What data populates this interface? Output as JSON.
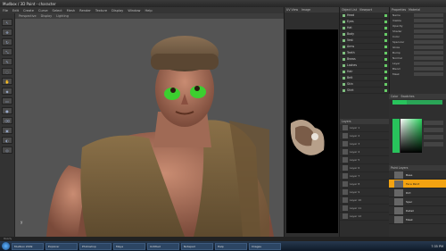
{
  "window": {
    "title": "Mudbox / 3D Paint - character"
  },
  "menu": [
    "File",
    "Edit",
    "Create",
    "Curve",
    "Select",
    "Mesh",
    "Render",
    "Texture",
    "Display",
    "Window",
    "Help"
  ],
  "viewport": {
    "tabs": [
      "Perspective",
      "Display",
      "Lighting"
    ],
    "axis_label": "y"
  },
  "uv_panel": {
    "tabs": [
      "UV View",
      "Image"
    ]
  },
  "object_list": {
    "tabs": [
      "Object List",
      "Viewport"
    ],
    "items": [
      "Head",
      "Eyes",
      "Hat",
      "Body",
      "Vest",
      "Arms",
      "Teeth",
      "Brows",
      "Lashes",
      "Hair",
      "Belt",
      "Skin",
      "Shirt"
    ]
  },
  "properties": {
    "tabs": [
      "Properties",
      "Material"
    ],
    "rows": [
      "Name",
      "Visible",
      "Opacity",
      "Shader",
      "Color",
      "Specular",
      "Gloss",
      "Bump",
      "Normal",
      "Layer",
      "Blend",
      "Mask"
    ]
  },
  "color_panel": {
    "tabs": [
      "Color",
      "Swatches"
    ]
  },
  "layers": {
    "tabs": [
      "Layers"
    ],
    "items": [
      "Layer 1",
      "Layer 2",
      "Layer 3",
      "Layer 4",
      "Layer 5",
      "Layer 6",
      "Layer 7",
      "Layer 8",
      "Layer 9",
      "Layer 10",
      "Layer 11",
      "Layer 12"
    ]
  },
  "paint_layers": {
    "tabs": [
      "Paint Layers"
    ],
    "items": [
      "Base",
      "Face Paint",
      "Dirt",
      "Spec",
      "Detail",
      "Mask"
    ],
    "selected_index": 1
  },
  "statusbar": "Ready",
  "taskbar": {
    "buttons": [
      "Mudbox 2009",
      "Explorer",
      "Photoshop",
      "Maya",
      "Untitled",
      "Notepad",
      "Help",
      "Images"
    ],
    "clock": "7:35 PM"
  },
  "colors": {
    "accent_green": "#28c35c",
    "selected_orange": "#f3a311"
  }
}
